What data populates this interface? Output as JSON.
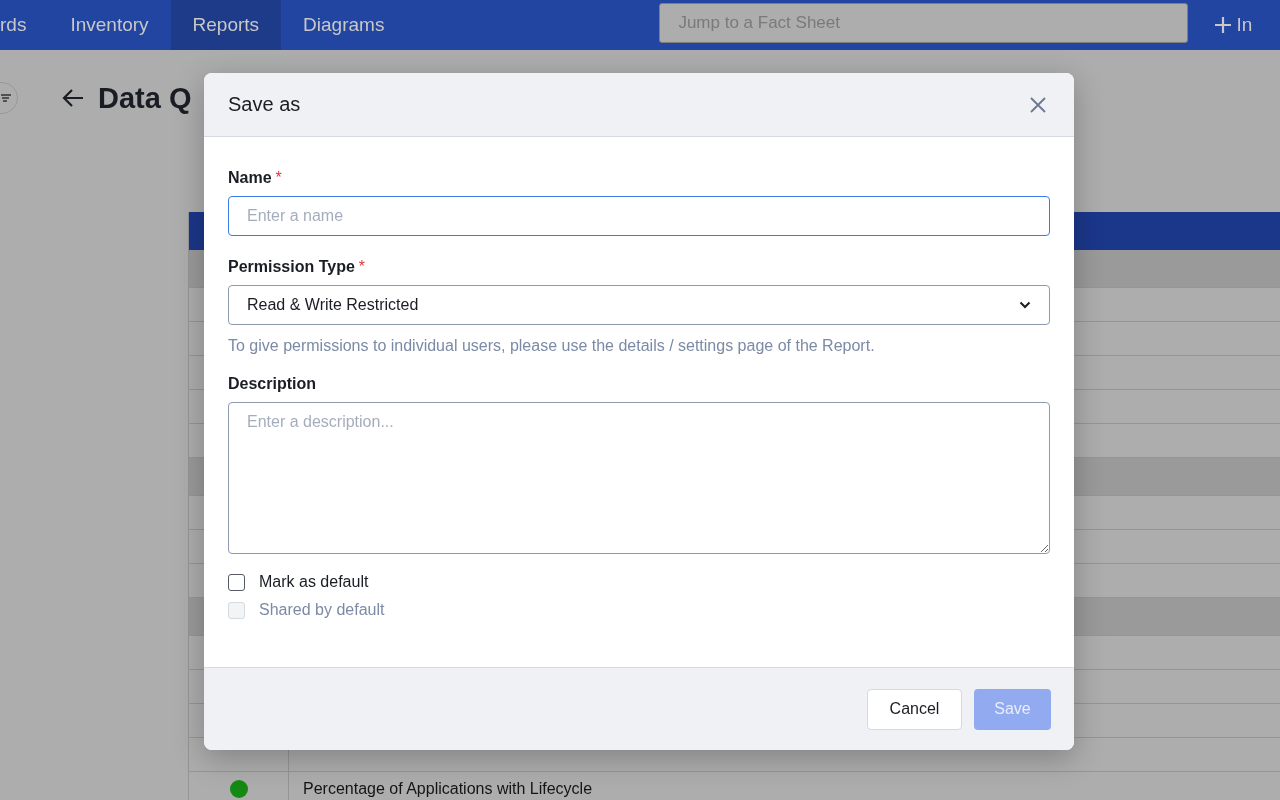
{
  "nav": {
    "tabs": [
      {
        "label": "rds",
        "selected": false
      },
      {
        "label": "Inventory",
        "selected": false
      },
      {
        "label": "Reports",
        "selected": true
      },
      {
        "label": "Diagrams",
        "selected": false
      }
    ],
    "search": {
      "placeholder": "Jump to a Fact Sheet"
    },
    "action": {
      "label": "In"
    }
  },
  "page": {
    "title": "Data Q"
  },
  "table": {
    "rows": [
      {
        "kind": "group"
      },
      {
        "kind": "row"
      },
      {
        "kind": "row"
      },
      {
        "kind": "row"
      },
      {
        "kind": "row"
      },
      {
        "kind": "row"
      },
      {
        "kind": "group"
      },
      {
        "kind": "row"
      },
      {
        "kind": "row"
      },
      {
        "kind": "row"
      },
      {
        "kind": "group"
      },
      {
        "kind": "row"
      },
      {
        "kind": "row"
      },
      {
        "kind": "row"
      },
      {
        "kind": "row"
      },
      {
        "kind": "row",
        "color": "#138a13",
        "text": "Percentage of Applications with Lifecycle"
      }
    ]
  },
  "dialog": {
    "title": "Save as",
    "name": {
      "label": "Name",
      "required_mark": "*",
      "placeholder": "Enter a name"
    },
    "permission": {
      "label": "Permission Type",
      "required_mark": "*",
      "value": "Read & Write Restricted",
      "hint": "To give permissions to individual users, please use the details / settings page of the Report."
    },
    "description": {
      "label": "Description",
      "placeholder": "Enter a description..."
    },
    "checkboxes": [
      {
        "label": "Mark as default",
        "checked": false,
        "disabled": false
      },
      {
        "label": "Shared by default",
        "checked": false,
        "disabled": true
      }
    ],
    "buttons": [
      {
        "label": "Cancel",
        "kind": "secondary",
        "disabled": false
      },
      {
        "label": "Save",
        "kind": "primary",
        "disabled": true
      }
    ]
  }
}
